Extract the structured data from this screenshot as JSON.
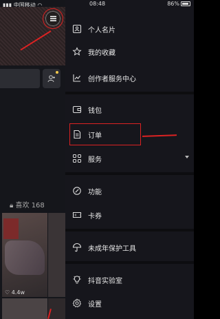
{
  "status": {
    "carrier": "中国移动",
    "time": "08:48",
    "battery": "86%"
  },
  "background": {
    "likes_label": "喜欢 168",
    "views": "4.4w"
  },
  "menu": {
    "items": [
      {
        "label": "个人名片",
        "icon": "id-card-icon"
      },
      {
        "label": "我的收藏",
        "icon": "star-icon"
      },
      {
        "label": "创作者服务中心",
        "icon": "chart-line-icon"
      },
      {
        "label": "钱包",
        "icon": "wallet-icon"
      },
      {
        "label": "订单",
        "icon": "order-doc-icon"
      },
      {
        "label": "服务",
        "icon": "grid-icon"
      },
      {
        "label": "功能",
        "icon": "link-icon"
      },
      {
        "label": "卡券",
        "icon": "ticket-icon"
      },
      {
        "label": "未成年保护工具",
        "icon": "umbrella-icon"
      },
      {
        "label": "抖音实验室",
        "icon": "bulb-icon"
      },
      {
        "label": "设置",
        "icon": "gear-icon"
      }
    ]
  },
  "colors": {
    "drawer_bg": "#16161c",
    "annotation_red": "#dd2222"
  }
}
